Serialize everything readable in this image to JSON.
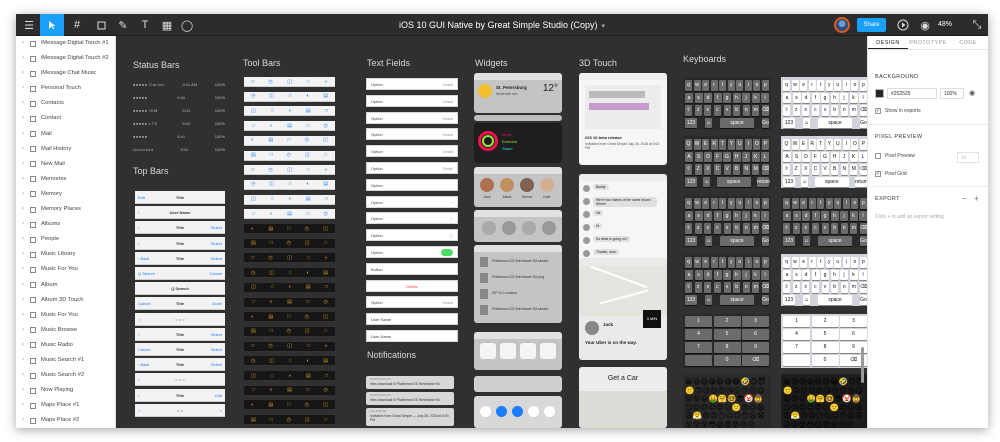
{
  "window": {
    "title": "iOS 10 GUI Native by Great Simple Studio (Copy)"
  },
  "toolbar": {
    "share_label": "Share",
    "zoom_label": "48%",
    "icons": [
      "menu-icon",
      "move-icon",
      "frame-icon",
      "rectangle-icon",
      "pen-icon",
      "text-icon",
      "component-icon",
      "comment-icon",
      "play-icon",
      "eye-icon",
      "expand-icon"
    ]
  },
  "layers": [
    "iMessage Digital Touch #1",
    "iMessage Digital Touch #2",
    "iMessage Chat Music",
    "Personal Touch",
    "Contacts",
    "Contact",
    "Mail",
    "Mail History",
    "New Mail",
    "Memories",
    "Memory",
    "Memory Places",
    "Albums",
    "People",
    "Music Library",
    "Music For You",
    "Album",
    "Album 3D Touch",
    "Music For You",
    "Music Browse",
    "Music Radio",
    "Music Search #1",
    "Music Search #2",
    "Now Playing",
    "Maps Place #1",
    "Maps Place #2"
  ],
  "canvas": {
    "sections": {
      "status_bars": "Status Bars",
      "top_bars": "Top Bars",
      "tool_bars": "Tool Bars",
      "text_fields": "Text Fields",
      "notifications": "Notifications",
      "widgets": "Widgets",
      "touch3d": "3D Touch",
      "keyboards": "Keyboards"
    },
    "status_bar_rows": [
      {
        "left": "●●●●● Carrier",
        "mid": "9:41 AM",
        "right": "100%"
      },
      {
        "left": "●●●●●",
        "mid": "9:41",
        "right": "100%"
      },
      {
        "left": "●●●●● SIM",
        "mid": "9:41",
        "right": "100%"
      },
      {
        "left": "●●●●● LTE",
        "mid": "9:41",
        "right": "100%"
      },
      {
        "left": "●●●●●",
        "mid": "9:41",
        "right": "100%"
      },
      {
        "left": "Unlocked",
        "mid": "9:41",
        "right": "100%"
      }
    ],
    "top_bars": [
      {
        "l": "Edit",
        "c": "Title",
        "r": ""
      },
      {
        "l": "‹",
        "c": "User Name",
        "r": ""
      },
      {
        "l": "‹",
        "c": "Title",
        "r": "Select"
      },
      {
        "l": "‹",
        "c": "Title",
        "r": "Select"
      },
      {
        "l": "‹ Back",
        "c": "Title",
        "r": "Select"
      },
      {
        "l": "Q Search",
        "c": "",
        "r": "Cancel"
      },
      {
        "l": "",
        "c": "Q Search",
        "r": ""
      },
      {
        "l": "Cancel",
        "c": "Title",
        "r": "Done"
      },
      {
        "l": "○",
        "c": "○  ○  ○",
        "r": ""
      },
      {
        "l": "‹",
        "c": "Title",
        "r": "Select"
      },
      {
        "l": "Cancel",
        "c": "Title",
        "r": "Select"
      },
      {
        "l": "‹ Back",
        "c": "Title",
        "r": "Select"
      },
      {
        "l": "○",
        "c": "○  ○  ○",
        "r": ""
      },
      {
        "l": "‹",
        "c": "Title",
        "r": "Edit"
      },
      {
        "l": "○",
        "c": "○  ○",
        "r": "○"
      }
    ],
    "text_fields": [
      {
        "l": "Option",
        "r": "Detail"
      },
      {
        "l": "Option",
        "r": "Detail"
      },
      {
        "l": "Option",
        "r": "Detail"
      },
      {
        "l": "Option",
        "r": "Detail"
      },
      {
        "l": "Option",
        "r": "Detail"
      },
      {
        "l": "Option",
        "r": "Detail"
      },
      {
        "l": "Option",
        "r": ""
      },
      {
        "l": "Option",
        "r": "›"
      },
      {
        "l": "Option",
        "r": "✓"
      },
      {
        "l": "Option",
        "r": "ⓘ"
      },
      {
        "l": "Option",
        "r": ""
      },
      {
        "l": "Button",
        "r": ""
      },
      {
        "l": "Delete",
        "r": ""
      },
      {
        "l": "Option",
        "r": "Detail"
      },
      {
        "l": "User Name",
        "r": ""
      },
      {
        "l": "User Name",
        "r": ""
      }
    ],
    "notifications": [
      {
        "app": "NOTIFICATION",
        "text": "New download of Platforma iOS Wireframe Kit"
      },
      {
        "app": "NOTIFICATION",
        "text": "New download of Platforma iOS Wireframe Kit"
      },
      {
        "app": "CALENDAR",
        "text": "Invitation from Great Simple — July 26, 2016 at 6:00 PM"
      }
    ],
    "widgets": {
      "weather": {
        "city": "St. Petersburg",
        "detail": "Moderate rain",
        "temp": "12°"
      },
      "activity": {
        "move": "Move",
        "exercise": "Exercise",
        "stand": "Stand"
      },
      "people": [
        "Jack",
        "Maria",
        "Emma",
        "Kate"
      ],
      "files": [
        "Platforma iOS Wireframe Kit.sketch",
        "Platforma iOS Wireframe Kit.png",
        "ZIP 10 Location",
        "Platforma iOS Wireframe Kit.sketch"
      ]
    },
    "touch3d": {
      "calendar": {
        "title": "iOS 10 beta release",
        "body": "Invitation from Great Simple July 26, 2016 at 6:00 PM"
      },
      "messages": [
        "Buddy",
        "We're two halves of the same brown Wheel",
        "Ok",
        "Hi",
        "So what is going on?",
        "Thanks, man"
      ],
      "maps": {
        "name": "Jack",
        "detail": "Your Uber is on the way.",
        "arrive": "3 MIN"
      },
      "car": "Get a Car"
    },
    "keyboard_rows": [
      [
        "q",
        "w",
        "e",
        "r",
        "t",
        "y",
        "u",
        "i",
        "o",
        "p"
      ],
      [
        "a",
        "s",
        "d",
        "f",
        "g",
        "h",
        "j",
        "k",
        "l"
      ],
      [
        "⇧",
        "z",
        "x",
        "c",
        "v",
        "b",
        "n",
        "m",
        "⌫"
      ],
      [
        "123",
        "☺",
        "space",
        "Go"
      ]
    ],
    "keyboard_rows_upper": [
      [
        "Q",
        "W",
        "E",
        "R",
        "T",
        "Y",
        "U",
        "I",
        "O",
        "P"
      ],
      [
        "A",
        "S",
        "D",
        "F",
        "G",
        "H",
        "J",
        "K",
        "L"
      ],
      [
        "⇧",
        "Z",
        "X",
        "C",
        "V",
        "B",
        "N",
        "M",
        "⌫"
      ],
      [
        "123",
        "☺",
        "space",
        "return"
      ]
    ],
    "numpad": [
      [
        "1",
        "2",
        "3"
      ],
      [
        "4",
        "5",
        "6"
      ],
      [
        "7",
        "8",
        "9"
      ],
      [
        "",
        "0",
        "⌫"
      ]
    ],
    "emoji": "😀😃😄😁😆😅😂🤣😊😇🙂🙃😉😌😍😘😗😙😚😋😜😝😛🤑🤗🤓😎🤡🤠😏😒😞😔😟😕🙁😣😖😫😩😤😠😡😶😐😑😯😦😧😮😲😵😳😱😨😰😢😥"
  },
  "props": {
    "tabs": [
      "DESIGN",
      "PROTOTYPE",
      "CODE"
    ],
    "background_label": "BACKGROUND",
    "bg_hex": "#252525",
    "opacity": "100%",
    "show_in_exports": "Show in exports",
    "pixel_preview_title": "PIXEL PREVIEW",
    "pixel_preview": "Pixel Preview",
    "pixel_grid": "Pixel Grid",
    "scale": "1x",
    "export_title": "EXPORT",
    "export_hint": "Click + to add an export setting"
  },
  "colors": {
    "accent": "#18a0fb",
    "canvas": "#303030",
    "toolbar": "#2c2c2c",
    "avatar_ring": "#e2581c"
  }
}
